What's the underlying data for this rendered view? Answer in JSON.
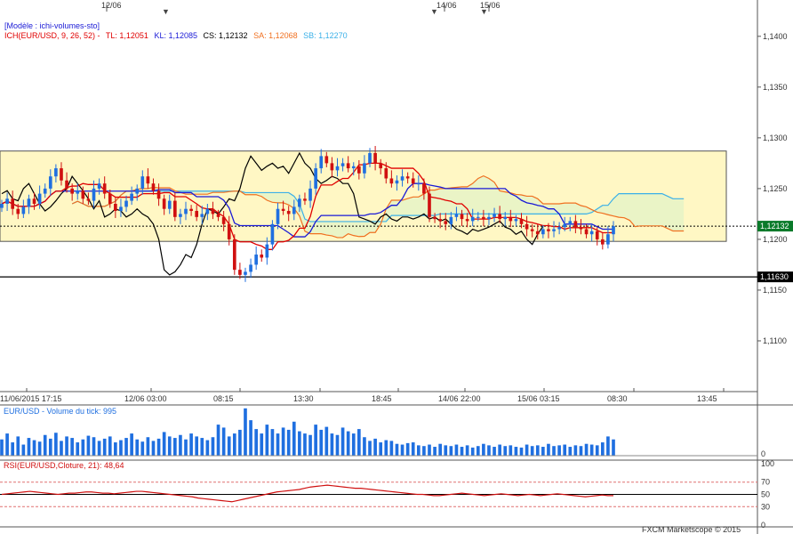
{
  "header": {
    "top_dates": [
      "12/06",
      "14/06",
      "15/06"
    ],
    "model_label": "[Modèle : ichi-volumes-sto]",
    "ichimoku": {
      "name": "ICH(EUR/USD, 9, 26, 52) -",
      "tl": "TL: 1,12051",
      "kl": "KL: 1,12085",
      "cs": "CS: 1,12132",
      "sa": "SA: 1,12068",
      "sb": "SB: 1,12270"
    }
  },
  "colors": {
    "tenkan": "#e00000",
    "kijun": "#1a1ad6",
    "chikou": "#000000",
    "senkou_a": "#f07020",
    "senkou_b": "#3ab0e8",
    "bull": "#1f6fe0",
    "bear": "#d01010",
    "box_fill": "#fff7c4",
    "volume": "#1f6fe0",
    "rsi": "#d01010"
  },
  "price_axis": {
    "ticks": [
      "1,1400",
      "1,1350",
      "1,1300",
      "1,1250",
      "1,1200",
      "1,1150",
      "1,1100"
    ],
    "last_price": "1,12132",
    "support_level": "1,11630"
  },
  "time_axis": [
    "11/06/2015 17:15",
    "12/06 03:00",
    "08:15",
    "13:30",
    "18:45",
    "14/06 22:00",
    "15/06 03:15",
    "08:30",
    "13:45"
  ],
  "volume_panel": {
    "title": "EUR/USD - Volume du tick: 995",
    "axis_zero": "0"
  },
  "rsi_panel": {
    "title": "RSI(EUR/USD,Cloture, 21): 48,64",
    "levels": [
      "100",
      "70",
      "50",
      "30",
      "0"
    ]
  },
  "footer": {
    "credit": "FXCM Marketscope © 2015"
  },
  "chart_data": [
    {
      "type": "candlestick",
      "symbol": "EUR/USD",
      "ylim": [
        1.105,
        1.142
      ],
      "closes": [
        1.1235,
        1.124,
        1.123,
        1.1225,
        1.1232,
        1.124,
        1.1235,
        1.1245,
        1.125,
        1.1262,
        1.127,
        1.1258,
        1.125,
        1.1245,
        1.1248,
        1.124,
        1.1238,
        1.125,
        1.1255,
        1.1245,
        1.1235,
        1.1228,
        1.1232,
        1.1238,
        1.1245,
        1.125,
        1.1262,
        1.1255,
        1.1248,
        1.124,
        1.123,
        1.1238,
        1.1222,
        1.1225,
        1.123,
        1.1228,
        1.1222,
        1.1225,
        1.123,
        1.1225,
        1.1222,
        1.1215,
        1.12,
        1.117,
        1.1165,
        1.1168,
        1.1175,
        1.1185,
        1.1182,
        1.1195,
        1.1215,
        1.123,
        1.1228,
        1.1225,
        1.1232,
        1.124,
        1.1238,
        1.125,
        1.127,
        1.1282,
        1.1275,
        1.1268,
        1.1272,
        1.1275,
        1.127,
        1.1272,
        1.1265,
        1.1275,
        1.1285,
        1.1275,
        1.127,
        1.126,
        1.1255,
        1.1258,
        1.1262,
        1.126,
        1.1255,
        1.1255,
        1.1245,
        1.1222,
        1.122,
        1.1218,
        1.1215,
        1.1222,
        1.1225,
        1.122,
        1.1218,
        1.1222,
        1.1222,
        1.122,
        1.1222,
        1.1225,
        1.122,
        1.1222,
        1.1218,
        1.122,
        1.1215,
        1.121,
        1.1208,
        1.1205,
        1.121,
        1.1208,
        1.121,
        1.1212,
        1.1215,
        1.1218,
        1.1212,
        1.121,
        1.1205,
        1.1208,
        1.12,
        1.1195,
        1.1205,
        1.1213
      ],
      "support_line": 1.1163,
      "ichimoku_box": [
        1.1198,
        1.1287
      ]
    },
    {
      "type": "bar",
      "name": "Volume du tick",
      "values": [
        220,
        300,
        180,
        260,
        150,
        240,
        210,
        190,
        280,
        230,
        310,
        200,
        260,
        240,
        180,
        220,
        270,
        250,
        200,
        230,
        260,
        180,
        210,
        240,
        300,
        220,
        190,
        250,
        200,
        230,
        320,
        260,
        240,
        280,
        220,
        300,
        260,
        240,
        210,
        250,
        420,
        380,
        260,
        300,
        350,
        640,
        480,
        360,
        300,
        420,
        360,
        300,
        380,
        350,
        460,
        330,
        300,
        280,
        420,
        350,
        390,
        300,
        280,
        380,
        330,
        300,
        360,
        250,
        200,
        230,
        180,
        210,
        200,
        160,
        150,
        170,
        180,
        140,
        130,
        150,
        120,
        160,
        140,
        130,
        150,
        120,
        140,
        110,
        130,
        160,
        140,
        120,
        150,
        130,
        140,
        120,
        110,
        150,
        130,
        140,
        120,
        160,
        130,
        140,
        150,
        120,
        140,
        130,
        160,
        150,
        140,
        180,
        260,
        220
      ],
      "max": 650
    },
    {
      "type": "line",
      "name": "RSI",
      "values": [
        50,
        51,
        52,
        53,
        54,
        55,
        54,
        53,
        52,
        51,
        50,
        51,
        52,
        52,
        53,
        54,
        54,
        53,
        52,
        52,
        51,
        52,
        53,
        54,
        55,
        55,
        54,
        53,
        52,
        51,
        50,
        49,
        48,
        47,
        46,
        44,
        43,
        42,
        41,
        40,
        39,
        38,
        40,
        42,
        44,
        46,
        48,
        50,
        52,
        54,
        55,
        56,
        57,
        58,
        60,
        62,
        63,
        64,
        65,
        64,
        63,
        62,
        61,
        60,
        60,
        59,
        58,
        57,
        56,
        55,
        54,
        53,
        52,
        51,
        50,
        50,
        49,
        48,
        48,
        49,
        50,
        51,
        52,
        51,
        50,
        49,
        48,
        49,
        50,
        51,
        50,
        49,
        48,
        49,
        50,
        49,
        48,
        49,
        50,
        51,
        50,
        49,
        48,
        47,
        46,
        47,
        48,
        49,
        48,
        48
      ],
      "ylim": [
        0,
        100
      ]
    }
  ]
}
